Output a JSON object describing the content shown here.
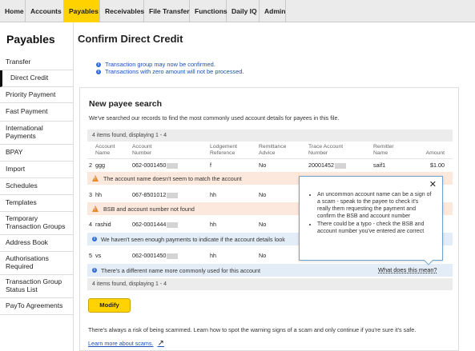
{
  "nav": {
    "tabs": [
      {
        "label": "Home"
      },
      {
        "label": "Accounts"
      },
      {
        "label": "Payables",
        "active": true
      },
      {
        "label": "Receivables"
      },
      {
        "label": "File Transfer"
      },
      {
        "label": "Functions"
      },
      {
        "label": "Daily IQ"
      },
      {
        "label": "Admin"
      }
    ]
  },
  "sidebar": {
    "title": "Payables",
    "items": [
      {
        "label": "Transfer"
      },
      {
        "label": "Direct Credit",
        "active": true
      },
      {
        "label": "Priority Payment"
      },
      {
        "label": "Fast Payment"
      },
      {
        "label": "International Payments"
      },
      {
        "label": "BPAY"
      },
      {
        "label": "Import"
      },
      {
        "label": "Schedules"
      },
      {
        "label": "Templates"
      },
      {
        "label": "Temporary Transaction Groups"
      },
      {
        "label": "Address Book"
      },
      {
        "label": "Authorisations Required"
      },
      {
        "label": "Transaction Group Status List"
      },
      {
        "label": "PayTo Agreements"
      }
    ]
  },
  "page": {
    "title": "Confirm Direct Credit",
    "info": [
      "Transaction group may now be confirmed.",
      "Transactions with zero amount will not be processed."
    ]
  },
  "payee_search": {
    "title": "New payee search",
    "subtitle": "We've searched our records to find the most commonly used account details for payees in this file.",
    "items_found": "4 items found, displaying 1 - 4",
    "columns": {
      "account_name": "Account Name",
      "account_number": "Account Number",
      "lodgement_reference": "Lodgement Reference",
      "remittance_advice": "Remittance Advice",
      "trace_account_number": "Trace Account Number",
      "remitter_name": "Remitter Name",
      "amount": "Amount"
    },
    "rows": [
      {
        "index": "2",
        "account_name": "ggg",
        "account_number": "062-0001450",
        "lodgement_reference": "f",
        "remittance_advice": "No",
        "trace_account_number": "20001452",
        "remitter_name": "saif1",
        "amount": "$1.00",
        "alert_type": "warning",
        "alert": "The account name doesn't seem to match the account"
      },
      {
        "index": "3",
        "account_name": "hh",
        "account_number": "067-8501012",
        "lodgement_reference": "hh",
        "remittance_advice": "No",
        "alert_type": "warning",
        "alert": "BSB and account number not found"
      },
      {
        "index": "4",
        "account_name": "rashid",
        "account_number": "062-0001444",
        "lodgement_reference": "hh",
        "remittance_advice": "No",
        "alert_type": "info",
        "alert": "We haven't seen enough payments to indicate if the account details look"
      },
      {
        "index": "5",
        "account_name": "vs",
        "account_number": "062-0001450",
        "lodgement_reference": "hh",
        "remittance_advice": "No",
        "alert_type": "info",
        "alert": "There's a different name more commonly used for this account"
      }
    ],
    "what_link": "What does this mean?"
  },
  "popup": {
    "points": [
      "An uncommon account name can be a sign of a scam - speak to the payee to check it's really them requesting the payment and confirm the BSB and account number",
      "There could be a typo - check the BSB and account number you've entered are correct"
    ]
  },
  "modify_label": "Modify",
  "scam_note": "There's always a risk of being scammed. Learn how to spot the warning signs of a scam and only continue if you're sure it's safe.",
  "learn_more": "Learn more about scams.",
  "colors": {
    "accent": "#ffd200",
    "link": "#1a51b8",
    "warning_bg": "#fce8dc",
    "info_bg": "#e3edf7",
    "popup_border": "#6fa3cf"
  }
}
